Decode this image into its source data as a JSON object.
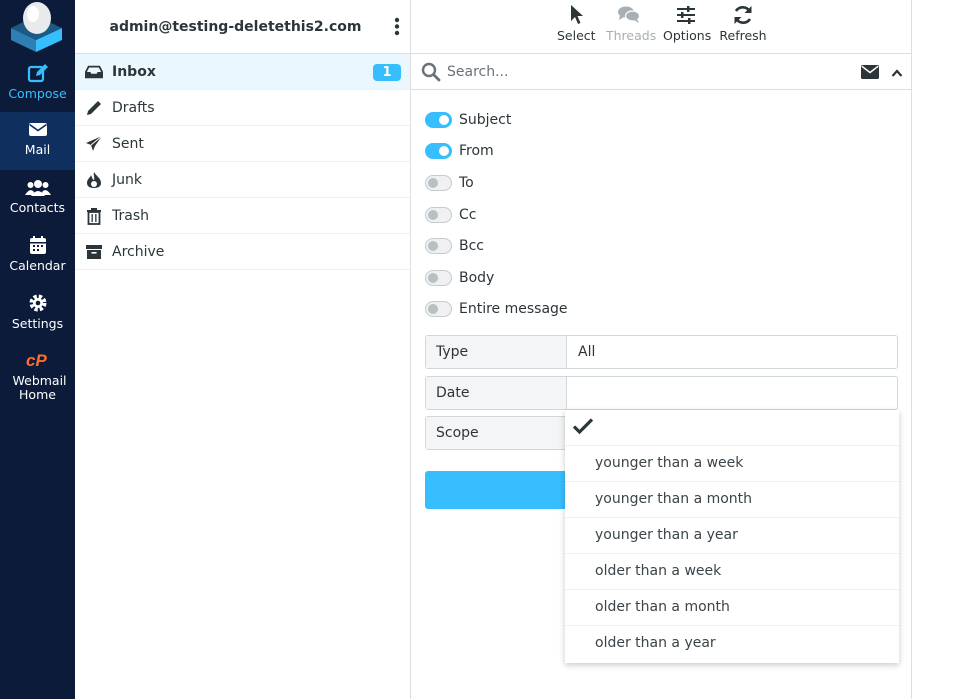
{
  "nav": {
    "compose": "Compose",
    "mail": "Mail",
    "contacts": "Contacts",
    "calendar": "Calendar",
    "settings": "Settings",
    "webmail_home": "Webmail Home"
  },
  "account": "admin@testing-deletethis2.com",
  "folders": [
    {
      "name": "Inbox",
      "unread": "1",
      "icon": "inbox-icon"
    },
    {
      "name": "Drafts",
      "icon": "pencil-icon"
    },
    {
      "name": "Sent",
      "icon": "paper-plane-icon"
    },
    {
      "name": "Junk",
      "icon": "fire-icon"
    },
    {
      "name": "Trash",
      "icon": "trash-icon"
    },
    {
      "name": "Archive",
      "icon": "archive-box-icon"
    }
  ],
  "toolbar": {
    "select": "Select",
    "threads": "Threads",
    "options": "Options",
    "refresh": "Refresh"
  },
  "search": {
    "placeholder": "Search..."
  },
  "search_options": {
    "toggles": [
      {
        "label": "Subject",
        "on": true
      },
      {
        "label": "From",
        "on": true
      },
      {
        "label": "To",
        "on": false
      },
      {
        "label": "Cc",
        "on": false
      },
      {
        "label": "Bcc",
        "on": false
      },
      {
        "label": "Body",
        "on": false
      },
      {
        "label": "Entire message",
        "on": false
      }
    ],
    "type_label": "Type",
    "type_value": "All",
    "date_label": "Date",
    "date_value": "",
    "scope_label": "Scope"
  },
  "date_dropdown": {
    "options": [
      "younger than a week",
      "younger than a month",
      "younger than a year",
      "older than a week",
      "older than a month",
      "older than a year"
    ]
  },
  "colors": {
    "nav_bg": "#0c1b3a",
    "accent": "#37beff",
    "cpanel_orange": "#ff6c2c"
  }
}
